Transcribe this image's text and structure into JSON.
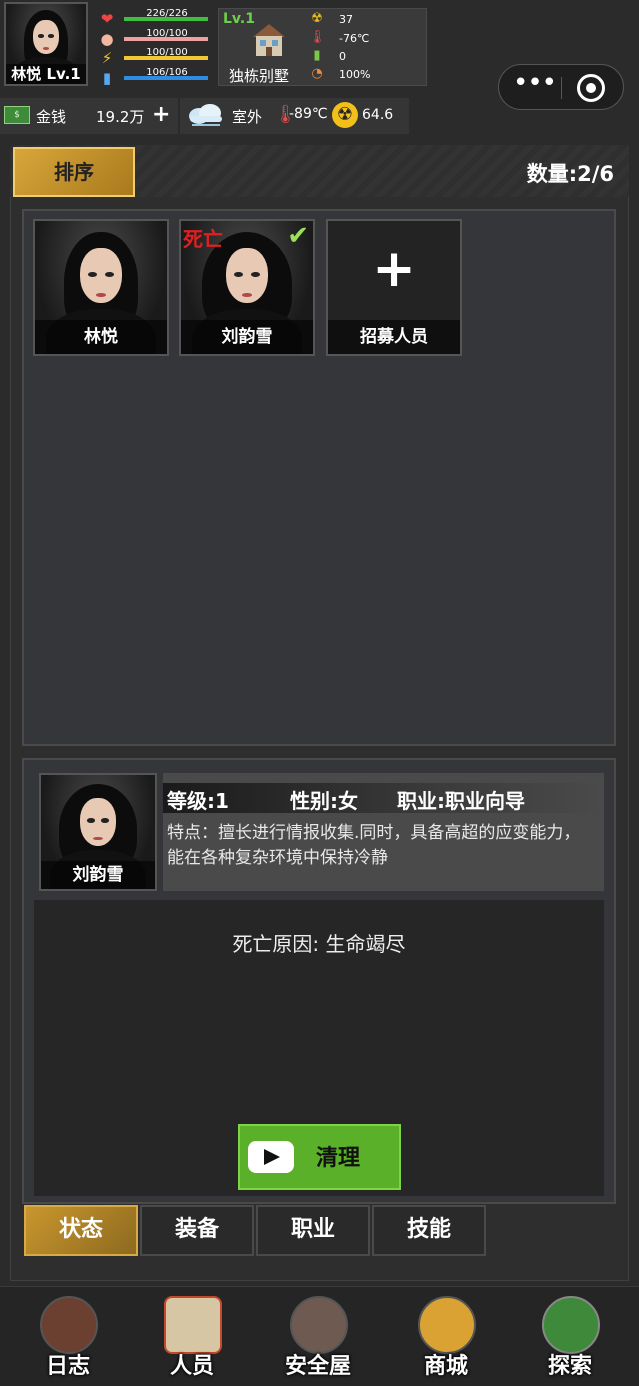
{
  "player": {
    "name_level": "林悦 Lv.1",
    "stats": [
      {
        "icon": "heart-icon",
        "value": "226/226",
        "color": "#3fbf3f",
        "fill": 1.0
      },
      {
        "icon": "stomach-icon",
        "value": "100/100",
        "color": "#f0a0a0",
        "fill": 1.0
      },
      {
        "icon": "energy-icon",
        "value": "100/100",
        "color": "#f2c634",
        "fill": 1.0
      },
      {
        "icon": "water-icon",
        "value": "106/106",
        "color": "#2e8de0",
        "fill": 1.0
      }
    ]
  },
  "house": {
    "level": "Lv.1",
    "name": "独栋别墅",
    "env": [
      {
        "icon": "radiation-icon",
        "value": "37"
      },
      {
        "icon": "thermometer-icon",
        "value": "-76℃"
      },
      {
        "icon": "battery-icon",
        "value": "0"
      },
      {
        "icon": "pie-icon",
        "value": "100%"
      }
    ]
  },
  "money": {
    "label": "金钱",
    "value": "19.2万",
    "plus": "+"
  },
  "weather": {
    "label": "室外",
    "temperature": "-89℃",
    "radiation": "64.6"
  },
  "roster": {
    "sort_label": "排序",
    "count_label": "数量:2/6",
    "cards": [
      {
        "name": "林悦"
      },
      {
        "name": "刘韵雪",
        "dead": "死亡",
        "check": "✔"
      }
    ],
    "recruit_label": "招募人员",
    "recruit_icon": "+"
  },
  "detail": {
    "name": "刘韵雪",
    "level": "等级:1",
    "gender": "性别:女",
    "job": "职业:职业向导",
    "trait": "特点：擅长进行情报收集.同时，具备高超的应变能力，能在各种复杂环境中保持冷静",
    "death_reason": "死亡原因: 生命竭尽",
    "clear_label": "清理"
  },
  "tabs": [
    "状态",
    "装备",
    "职业",
    "技能"
  ],
  "nav": [
    "日志",
    "人员",
    "安全屋",
    "商城",
    "探索"
  ],
  "mini_program": {
    "more": "•••"
  }
}
